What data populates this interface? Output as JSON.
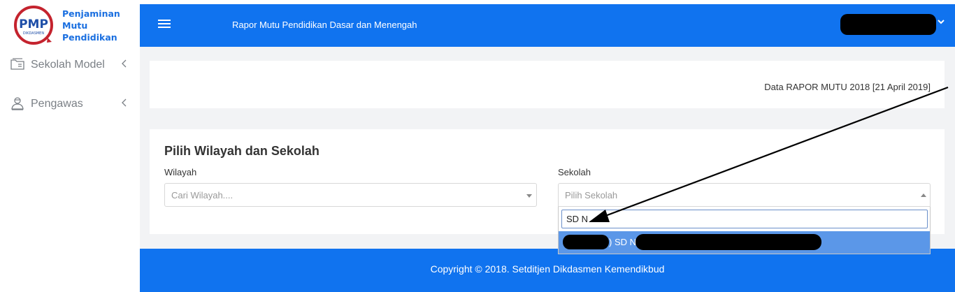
{
  "brand": {
    "logo_text": "PMP",
    "logo_subtext": "DIKDASMEN",
    "line1": "Penjaminan",
    "line2": "Mutu",
    "line3": "Pendidikan"
  },
  "sidebar": {
    "items": [
      {
        "label": "Sekolah Model",
        "icon": "folder-icon"
      },
      {
        "label": "Pengawas",
        "icon": "inspector-icon"
      }
    ]
  },
  "header": {
    "title": "Rapor Mutu Pendidikan Dasar dan Menengah",
    "user_name": ""
  },
  "info": {
    "text": "Data RAPOR MUTU 2018 [21 April 2019]"
  },
  "form": {
    "title": "Pilih Wilayah dan Sekolah",
    "wilayah_label": "Wilayah",
    "wilayah_placeholder": "Cari Wilayah....",
    "sekolah_label": "Sekolah",
    "sekolah_placeholder": "Pilih Sekolah",
    "search_value": "SD N",
    "option_text": ") SD N"
  },
  "footer": {
    "text": "Copyright © 2018. Setditjen Dikdasmen Kemendikbud"
  },
  "colors": {
    "primary": "#1073ef",
    "option_highlight": "#5b97e8",
    "brand_red": "#c4232e",
    "redaction": "#000000"
  }
}
